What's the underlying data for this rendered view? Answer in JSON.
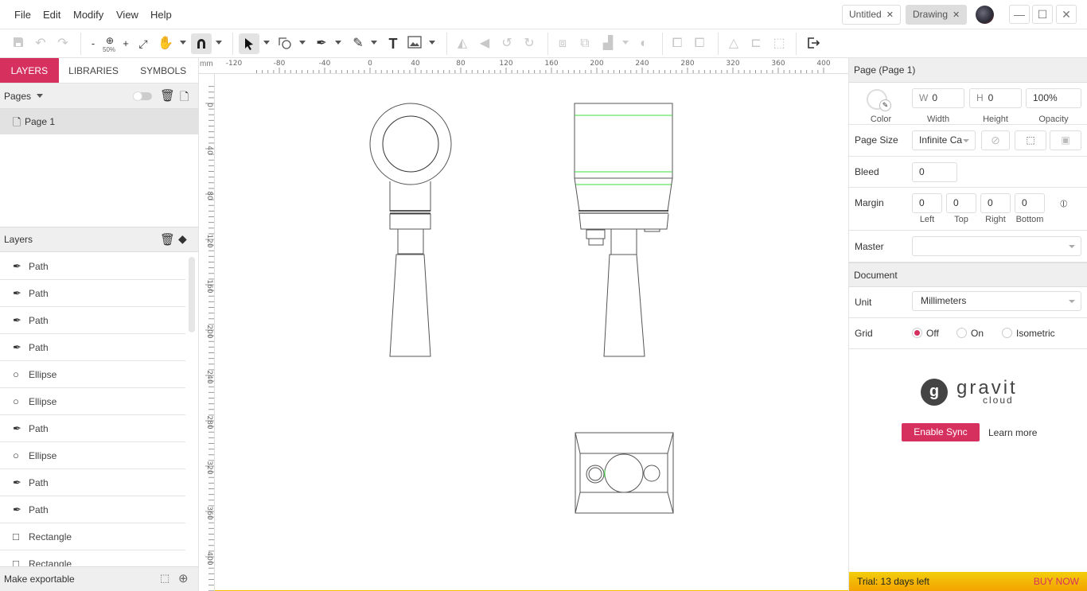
{
  "menu": [
    "File",
    "Edit",
    "Modify",
    "View",
    "Help"
  ],
  "doc_tabs": [
    {
      "label": "Untitled",
      "active": false
    },
    {
      "label": "Drawing",
      "active": true
    }
  ],
  "window_controls": {
    "minimize": "—",
    "maximize": "☐",
    "close": "✕"
  },
  "toolbar": {
    "zoom_level": "50%",
    "zoom_out": "-",
    "zoom_in": "+"
  },
  "left_panel": {
    "tabs": [
      "LAYERS",
      "LIBRARIES",
      "SYMBOLS"
    ],
    "pages_label": "Pages",
    "page_items": [
      "Page 1"
    ],
    "layers_label": "Layers",
    "layers": [
      {
        "type": "path",
        "label": "Path"
      },
      {
        "type": "path",
        "label": "Path"
      },
      {
        "type": "path",
        "label": "Path"
      },
      {
        "type": "path",
        "label": "Path"
      },
      {
        "type": "ellipse",
        "label": "Ellipse"
      },
      {
        "type": "ellipse",
        "label": "Ellipse"
      },
      {
        "type": "path",
        "label": "Path"
      },
      {
        "type": "ellipse",
        "label": "Ellipse"
      },
      {
        "type": "path",
        "label": "Path"
      },
      {
        "type": "path",
        "label": "Path"
      },
      {
        "type": "rectangle",
        "label": "Rectangle"
      },
      {
        "type": "rectangle",
        "label": "Rectangle"
      }
    ],
    "export_label": "Make exportable"
  },
  "rulers": {
    "unit": "mm",
    "h_ticks": [
      "-120",
      "-80",
      "-40",
      "0",
      "40",
      "80",
      "120",
      "160",
      "200",
      "240",
      "280",
      "320",
      "360",
      "400"
    ],
    "v_ticks": [
      "0",
      "40",
      "80",
      "120",
      "160",
      "200",
      "240",
      "280",
      "320",
      "360",
      "400"
    ]
  },
  "right_panel": {
    "page_title": "Page (Page 1)",
    "color_label": "Color",
    "width": {
      "prefix": "W",
      "value": "0",
      "label": "Width"
    },
    "height": {
      "prefix": "H",
      "value": "0",
      "label": "Height"
    },
    "opacity": {
      "value": "100%",
      "label": "Opacity"
    },
    "page_size": {
      "label": "Page Size",
      "value": "Infinite Ca"
    },
    "bleed": {
      "label": "Bleed",
      "value": "0"
    },
    "margin": {
      "label": "Margin",
      "left": "0",
      "top": "0",
      "right": "0",
      "bottom": "0",
      "left_label": "Left",
      "top_label": "Top",
      "right_label": "Right",
      "bottom_label": "Bottom"
    },
    "master": {
      "label": "Master",
      "value": ""
    },
    "document_title": "Document",
    "unit": {
      "label": "Unit",
      "value": "Millimeters"
    },
    "grid": {
      "label": "Grid",
      "options": [
        "Off",
        "On",
        "Isometric"
      ],
      "selected": "Off"
    },
    "cloud": {
      "brand": "gravit",
      "sub": "cloud",
      "enable_sync": "Enable Sync",
      "learn_more": "Learn more"
    },
    "trial": {
      "text": "Trial: 13 days left",
      "buy": "BUY NOW"
    }
  },
  "colors": {
    "accent": "#d6305f",
    "guide_green": "#3ddc3d"
  }
}
